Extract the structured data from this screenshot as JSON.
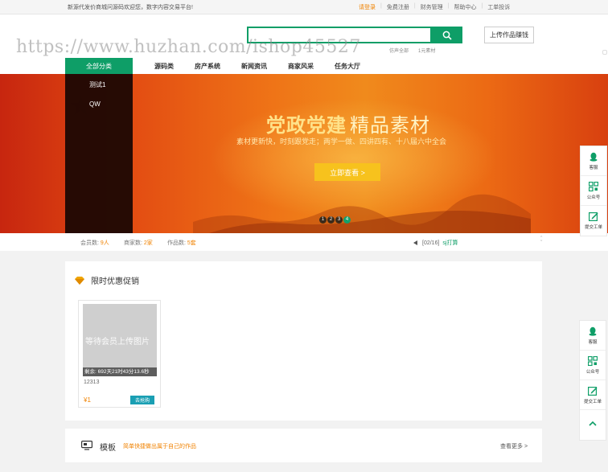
{
  "topbar": {
    "welcome": "新源代发价商城问源码欢迎您，数字内容交易平台!",
    "links": [
      "请登录",
      "免费注册",
      "财务管理",
      "帮助中心",
      "工单投诉"
    ]
  },
  "header": {
    "search_placeholder": "",
    "hotwords": [
      "仿声全部",
      "1元素材"
    ],
    "upload_label": "上传作品赚钱"
  },
  "nav": {
    "all_categories": "全部分类",
    "items": [
      "源码类",
      "房产系统",
      "新闻资讯",
      "商家风采",
      "任务大厅"
    ]
  },
  "category_panel": {
    "items": [
      "测试1",
      "QW"
    ]
  },
  "banner": {
    "title_bold": "党政党建",
    "title_thin": "精品素材",
    "subtitle": "素材更新快，时刻跟党走；两学一做、四讲四有、十八届六中全会",
    "cta": "立即查看 >",
    "dots": [
      "1",
      "2",
      "3",
      "4"
    ]
  },
  "stats": {
    "members_label": "会员数:",
    "members_value": "9人",
    "merchants_label": "商家数:",
    "merchants_value": "2家",
    "works_label": "作品数:",
    "works_value": "5套",
    "notice_index": "[02/16]",
    "notice_link": "sj打算"
  },
  "promo": {
    "title": "限时优惠促销",
    "card": {
      "thumb_text": "等待会员上传图片",
      "countdown": "剩余: 692天21时43分13.6秒",
      "name": "12313",
      "price": "¥1",
      "buy": "去抢购"
    }
  },
  "template_section": {
    "title": "模板",
    "desc": "简单快捷做出属于自己的作品",
    "more": "查看更多 >"
  },
  "float_panel": {
    "items": [
      "客服",
      "公众号",
      "提交工单"
    ]
  },
  "overlay_watermark": "https://www.huzhan.com/ishop45527"
}
